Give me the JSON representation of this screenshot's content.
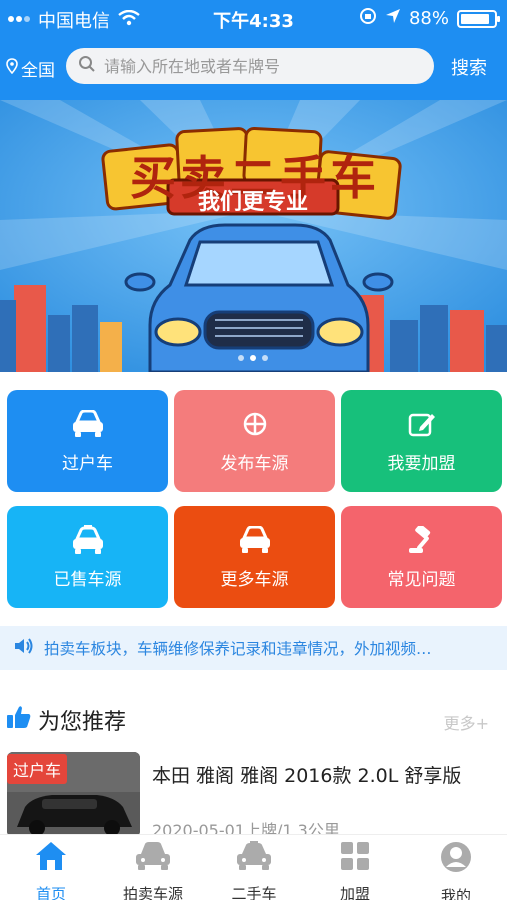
{
  "status_bar": {
    "carrier": "中国电信",
    "time": "下午4:33",
    "battery_percent": "88%",
    "battery_level": 0.88
  },
  "header": {
    "location": "全国",
    "search_placeholder": "请输入所在地或者车牌号",
    "search_button": "搜索"
  },
  "banner": {
    "line1": "买卖二手车",
    "line2": "我们更专业"
  },
  "grid": [
    {
      "label": "过户车",
      "color": "#1e8ef2",
      "icon": "car-icon"
    },
    {
      "label": "发布车源",
      "color": "#f47c7c",
      "icon": "crosshair-icon"
    },
    {
      "label": "我要加盟",
      "color": "#17c07b",
      "icon": "edit-icon"
    },
    {
      "label": "已售车源",
      "color": "#17b4f6",
      "icon": "taxi-icon"
    },
    {
      "label": "更多车源",
      "color": "#eb4d11",
      "icon": "car-icon"
    },
    {
      "label": "常见问题",
      "color": "#f4646c",
      "icon": "gavel-icon"
    }
  ],
  "notice": {
    "text": "拍卖车板块，车辆维修保养记录和违章情况，外加视频…"
  },
  "recommend": {
    "title": "为您推荐",
    "more": "更多+",
    "items": [
      {
        "tag": "过户车",
        "title": "本田 雅阁 雅阁 2016款 2.0L 舒享版",
        "meta": "2020-05-01上牌/1.3公里"
      }
    ]
  },
  "tabbar": {
    "active_color": "#1e8ef2",
    "items": [
      {
        "label": "首页",
        "icon": "home-icon",
        "active": true
      },
      {
        "label": "拍卖车源",
        "icon": "car-icon",
        "active": false
      },
      {
        "label": "二手车",
        "icon": "taxi-icon",
        "active": false
      },
      {
        "label": "加盟",
        "icon": "grid-icon",
        "active": false
      },
      {
        "label": "我的",
        "icon": "user-icon",
        "active": false
      }
    ]
  }
}
